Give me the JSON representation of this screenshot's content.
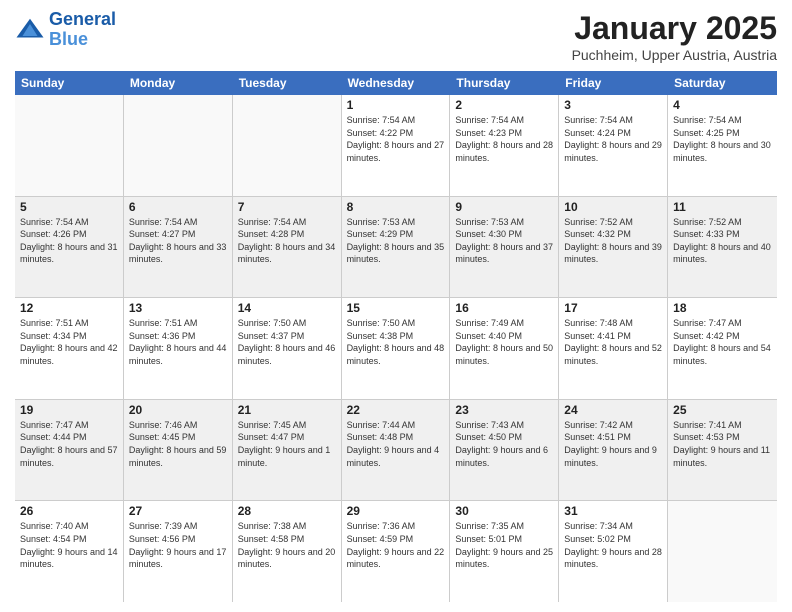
{
  "logo": {
    "line1": "General",
    "line2": "Blue"
  },
  "header": {
    "title": "January 2025",
    "location": "Puchheim, Upper Austria, Austria"
  },
  "days_of_week": [
    "Sunday",
    "Monday",
    "Tuesday",
    "Wednesday",
    "Thursday",
    "Friday",
    "Saturday"
  ],
  "weeks": [
    [
      {
        "day": "",
        "empty": true
      },
      {
        "day": "",
        "empty": true
      },
      {
        "day": "",
        "empty": true
      },
      {
        "day": "1",
        "sunrise": "7:54 AM",
        "sunset": "4:22 PM",
        "daylight": "8 hours and 27 minutes."
      },
      {
        "day": "2",
        "sunrise": "7:54 AM",
        "sunset": "4:23 PM",
        "daylight": "8 hours and 28 minutes."
      },
      {
        "day": "3",
        "sunrise": "7:54 AM",
        "sunset": "4:24 PM",
        "daylight": "8 hours and 29 minutes."
      },
      {
        "day": "4",
        "sunrise": "7:54 AM",
        "sunset": "4:25 PM",
        "daylight": "8 hours and 30 minutes."
      }
    ],
    [
      {
        "day": "5",
        "sunrise": "7:54 AM",
        "sunset": "4:26 PM",
        "daylight": "8 hours and 31 minutes."
      },
      {
        "day": "6",
        "sunrise": "7:54 AM",
        "sunset": "4:27 PM",
        "daylight": "8 hours and 33 minutes."
      },
      {
        "day": "7",
        "sunrise": "7:54 AM",
        "sunset": "4:28 PM",
        "daylight": "8 hours and 34 minutes."
      },
      {
        "day": "8",
        "sunrise": "7:53 AM",
        "sunset": "4:29 PM",
        "daylight": "8 hours and 35 minutes."
      },
      {
        "day": "9",
        "sunrise": "7:53 AM",
        "sunset": "4:30 PM",
        "daylight": "8 hours and 37 minutes."
      },
      {
        "day": "10",
        "sunrise": "7:52 AM",
        "sunset": "4:32 PM",
        "daylight": "8 hours and 39 minutes."
      },
      {
        "day": "11",
        "sunrise": "7:52 AM",
        "sunset": "4:33 PM",
        "daylight": "8 hours and 40 minutes."
      }
    ],
    [
      {
        "day": "12",
        "sunrise": "7:51 AM",
        "sunset": "4:34 PM",
        "daylight": "8 hours and 42 minutes."
      },
      {
        "day": "13",
        "sunrise": "7:51 AM",
        "sunset": "4:36 PM",
        "daylight": "8 hours and 44 minutes."
      },
      {
        "day": "14",
        "sunrise": "7:50 AM",
        "sunset": "4:37 PM",
        "daylight": "8 hours and 46 minutes."
      },
      {
        "day": "15",
        "sunrise": "7:50 AM",
        "sunset": "4:38 PM",
        "daylight": "8 hours and 48 minutes."
      },
      {
        "day": "16",
        "sunrise": "7:49 AM",
        "sunset": "4:40 PM",
        "daylight": "8 hours and 50 minutes."
      },
      {
        "day": "17",
        "sunrise": "7:48 AM",
        "sunset": "4:41 PM",
        "daylight": "8 hours and 52 minutes."
      },
      {
        "day": "18",
        "sunrise": "7:47 AM",
        "sunset": "4:42 PM",
        "daylight": "8 hours and 54 minutes."
      }
    ],
    [
      {
        "day": "19",
        "sunrise": "7:47 AM",
        "sunset": "4:44 PM",
        "daylight": "8 hours and 57 minutes."
      },
      {
        "day": "20",
        "sunrise": "7:46 AM",
        "sunset": "4:45 PM",
        "daylight": "8 hours and 59 minutes."
      },
      {
        "day": "21",
        "sunrise": "7:45 AM",
        "sunset": "4:47 PM",
        "daylight": "9 hours and 1 minute."
      },
      {
        "day": "22",
        "sunrise": "7:44 AM",
        "sunset": "4:48 PM",
        "daylight": "9 hours and 4 minutes."
      },
      {
        "day": "23",
        "sunrise": "7:43 AM",
        "sunset": "4:50 PM",
        "daylight": "9 hours and 6 minutes."
      },
      {
        "day": "24",
        "sunrise": "7:42 AM",
        "sunset": "4:51 PM",
        "daylight": "9 hours and 9 minutes."
      },
      {
        "day": "25",
        "sunrise": "7:41 AM",
        "sunset": "4:53 PM",
        "daylight": "9 hours and 11 minutes."
      }
    ],
    [
      {
        "day": "26",
        "sunrise": "7:40 AM",
        "sunset": "4:54 PM",
        "daylight": "9 hours and 14 minutes."
      },
      {
        "day": "27",
        "sunrise": "7:39 AM",
        "sunset": "4:56 PM",
        "daylight": "9 hours and 17 minutes."
      },
      {
        "day": "28",
        "sunrise": "7:38 AM",
        "sunset": "4:58 PM",
        "daylight": "9 hours and 20 minutes."
      },
      {
        "day": "29",
        "sunrise": "7:36 AM",
        "sunset": "4:59 PM",
        "daylight": "9 hours and 22 minutes."
      },
      {
        "day": "30",
        "sunrise": "7:35 AM",
        "sunset": "5:01 PM",
        "daylight": "9 hours and 25 minutes."
      },
      {
        "day": "31",
        "sunrise": "7:34 AM",
        "sunset": "5:02 PM",
        "daylight": "9 hours and 28 minutes."
      },
      {
        "day": "",
        "empty": true
      }
    ]
  ],
  "shaded_weeks": [
    1,
    3
  ]
}
